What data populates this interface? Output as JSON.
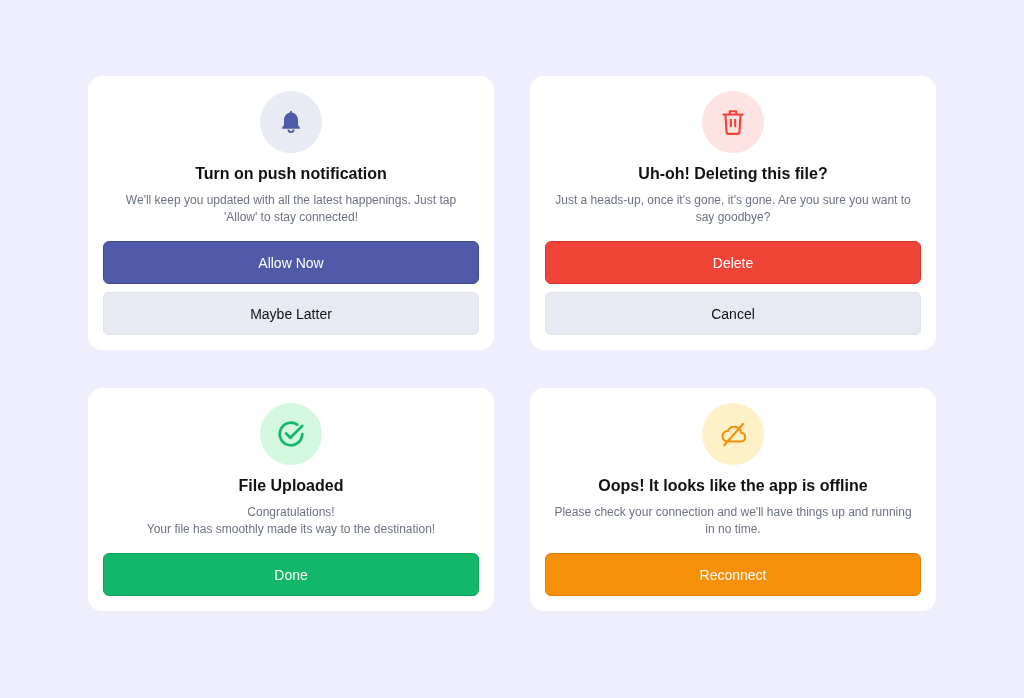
{
  "cards": [
    {
      "kind": "notification",
      "title": "Turn on push notification",
      "message": "We'll keep you updated with all the latest happenings. Just tap 'Allow' to stay connected!",
      "buttons": [
        {
          "label": "Allow Now",
          "kind": "primary"
        },
        {
          "label": "Maybe Latter",
          "kind": "secondary"
        }
      ]
    },
    {
      "kind": "delete",
      "title": "Uh-oh! Deleting this file?",
      "message": "Just a heads-up, once it's gone, it's gone. Are you sure you want to say goodbye?",
      "buttons": [
        {
          "label": "Delete",
          "kind": "primary"
        },
        {
          "label": "Cancel",
          "kind": "secondary"
        }
      ]
    },
    {
      "kind": "success",
      "title": "File Uploaded",
      "message": "Congratulations!\nYour file has smoothly made its way to the destination!",
      "buttons": [
        {
          "label": "Done",
          "kind": "primary"
        }
      ]
    },
    {
      "kind": "offline",
      "title": "Oops! It looks like the app is offline",
      "message": "Please check your connection and we'll have things up and running in no time.",
      "buttons": [
        {
          "label": "Reconnect",
          "kind": "primary"
        }
      ]
    }
  ]
}
